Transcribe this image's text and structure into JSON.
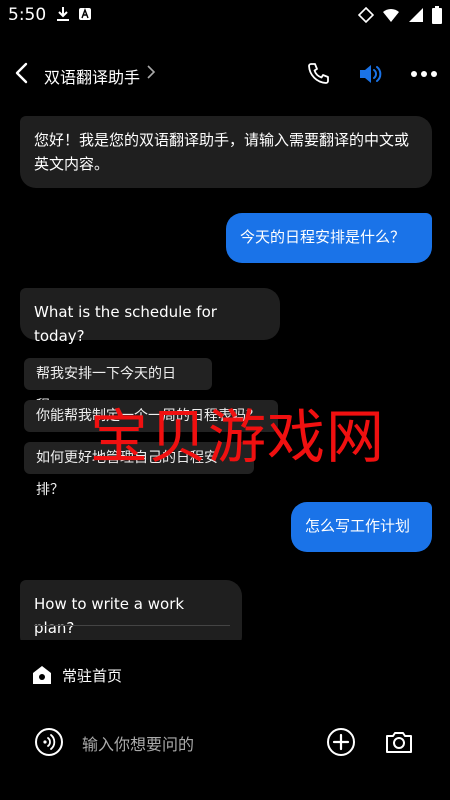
{
  "status": {
    "time": "5:50"
  },
  "header": {
    "title": "双语翻译助手"
  },
  "chat": {
    "bot_greeting": "您好！我是您的双语翻译助手，请输入需要翻译的中文或英文内容。",
    "user_msg_1": "今天的日程安排是什么？",
    "bot_reply_1": "What is the schedule for today?",
    "suggestions": [
      "帮我安排一下今天的日程。",
      "你能帮我制定一个一周的日程表吗？",
      "如何更好地管理自己的日程安排？"
    ],
    "user_msg_2": "怎么写工作计划",
    "bot_reply_2": "How to write a work plan?"
  },
  "watermark": "宝贝游戏网",
  "pin": {
    "label": "常驻首页"
  },
  "input": {
    "placeholder": "输入你想要问的"
  },
  "colors": {
    "accent": "#1a73e8",
    "bubble_bot": "#1f1f1f",
    "watermark": "#f01010"
  }
}
